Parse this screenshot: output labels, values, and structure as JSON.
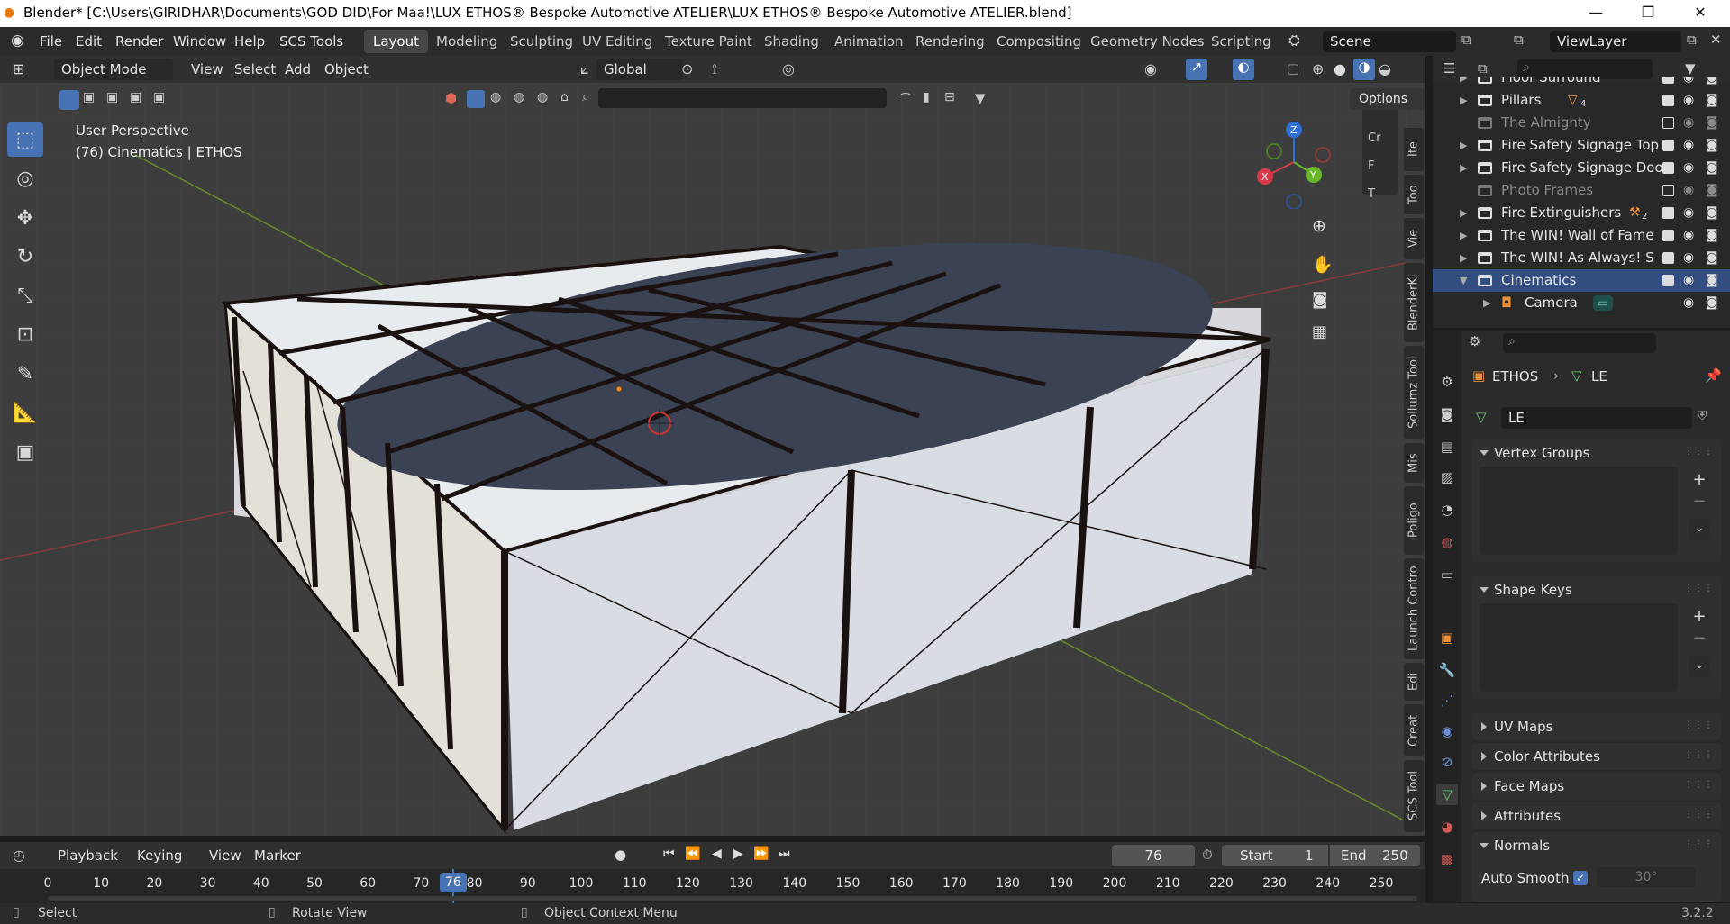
{
  "title_bar": {
    "text": "Blender* [C:\\Users\\GIRIDHAR\\Documents\\GOD DID\\For Maa!\\LUX ETHOS® Bespoke Automotive ATELIER\\LUX ETHOS® Bespoke Automotive ATELIER.blend]"
  },
  "menus": [
    "File",
    "Edit",
    "Render",
    "Window",
    "Help",
    "SCS Tools"
  ],
  "workspaces": [
    "Layout",
    "Modeling",
    "Sculpting",
    "UV Editing",
    "Texture Paint",
    "Shading",
    "Animation",
    "Rendering",
    "Compositing",
    "Geometry Nodes",
    "Scripting"
  ],
  "active_workspace": "Layout",
  "scene": {
    "label": "Scene"
  },
  "view_layer": {
    "label": "ViewLayer"
  },
  "viewport_header": {
    "mode": "Object Mode",
    "menus": [
      "View",
      "Select",
      "Add",
      "Object"
    ],
    "orientation": "Global",
    "options": "Options"
  },
  "viewport": {
    "perspective": "User Perspective",
    "context": "(76) Cinematics | ETHOS",
    "side_tabs": [
      "Ite",
      "Too",
      "Vie",
      "BlenderKi",
      "Sollumz Tool",
      "Mis",
      "Poligo",
      "Launch Contro",
      "Edi",
      "Creat",
      "SCS Tool"
    ],
    "mini_panel": [
      "Cr",
      "F",
      "T"
    ],
    "gizmo": {
      "x": "X",
      "y": "Y",
      "z": "Z"
    }
  },
  "outliner": {
    "rows": [
      {
        "name": "Floor Surround",
        "partial": true
      },
      {
        "name": "Pillars",
        "badge": "4",
        "checked": true
      },
      {
        "name": "The Almighty",
        "dim": true,
        "checked": false
      },
      {
        "name": "Fire Safety Signage Top",
        "checked": true
      },
      {
        "name": "Fire Safety Signage Door",
        "checked": true
      },
      {
        "name": "Photo Frames",
        "dim": true,
        "checked": false
      },
      {
        "name": "Fire Extinguishers",
        "badge": "2",
        "checked": true
      },
      {
        "name": "The WIN! Wall of Fame",
        "checked": true
      },
      {
        "name": "The WIN! As Always! Stat",
        "checked": true
      },
      {
        "name": "Cinematics",
        "checked": true,
        "selected": true
      },
      {
        "name": "Camera",
        "child": true
      }
    ]
  },
  "properties": {
    "breadcrumb_object": "ETHOS",
    "breadcrumb_data": "LE",
    "data_name": "LE",
    "panels": {
      "vertex_groups": "Vertex Groups",
      "shape_keys": "Shape Keys",
      "uv_maps": "UV Maps",
      "color_attributes": "Color Attributes",
      "face_maps": "Face Maps",
      "attributes": "Attributes",
      "normals": "Normals"
    },
    "auto_smooth_label": "Auto Smooth",
    "auto_smooth_angle": "30°"
  },
  "timeline": {
    "menus": [
      "Playback",
      "Keying",
      "View",
      "Marker"
    ],
    "current_frame": "76",
    "start_label": "Start",
    "start": "1",
    "end_label": "End",
    "end": "250",
    "ticks": [
      "0",
      "10",
      "20",
      "30",
      "40",
      "50",
      "60",
      "70",
      "80",
      "90",
      "100",
      "110",
      "120",
      "130",
      "140",
      "150",
      "160",
      "170",
      "180",
      "190",
      "200",
      "210",
      "220",
      "230",
      "240",
      "250"
    ]
  },
  "status_bar": {
    "select": "Select",
    "rotate": "Rotate View",
    "context": "Object Context Menu",
    "version": "3.2.2"
  },
  "colors": {
    "accent": "#4772b3",
    "selected_row": "#334d80",
    "viewport_bg": "#3d3d3d"
  }
}
